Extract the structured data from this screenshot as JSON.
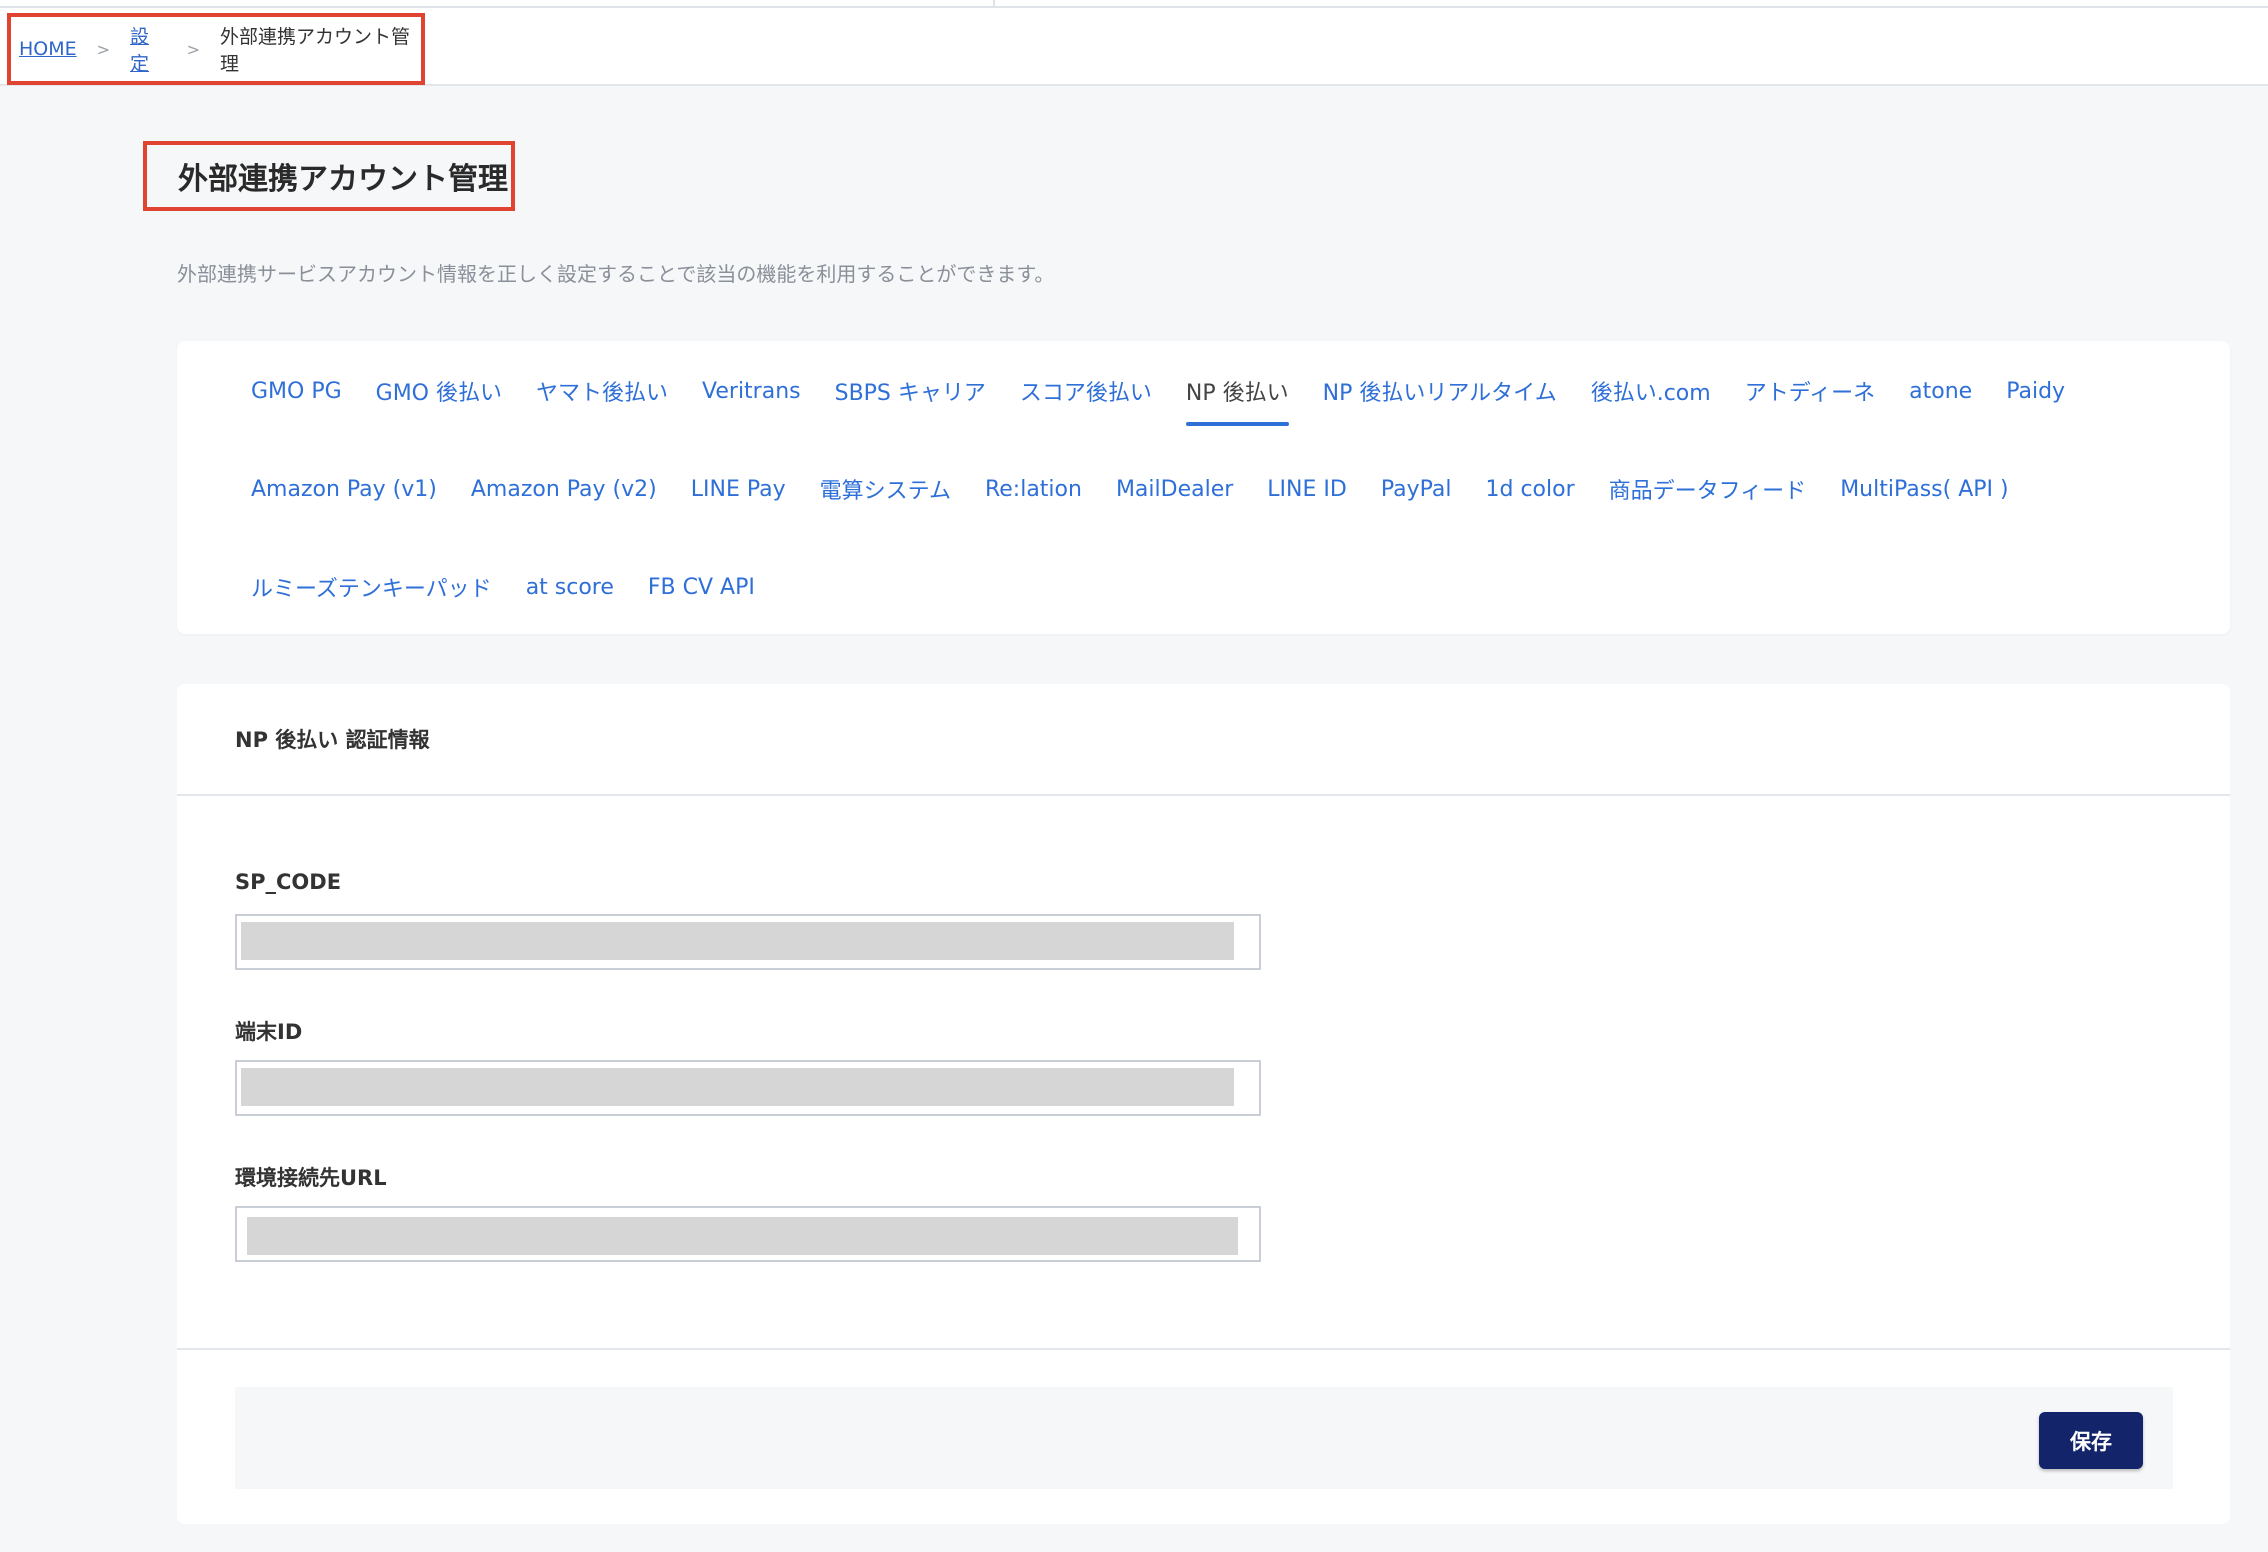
{
  "breadcrumb": {
    "home": "HOME",
    "settings": "設定",
    "current": "外部連携アカウント管理",
    "separator": ">"
  },
  "page": {
    "title": "外部連携アカウント管理",
    "description": "外部連携サービスアカウント情報を正しく設定することで該当の機能を利用することができます。"
  },
  "tabs": {
    "row1": [
      "GMO PG",
      "GMO 後払い",
      "ヤマト後払い",
      "Veritrans",
      "SBPS キャリア",
      "スコア後払い",
      "NP 後払い",
      "NP 後払いリアルタイム",
      "後払い.com",
      "アトディーネ",
      "atone",
      "Paidy"
    ],
    "row2": [
      "Amazon Pay (v1)",
      "Amazon Pay (v2)",
      "LINE Pay",
      "電算システム",
      "Re:lation",
      "MailDealer",
      "LINE ID",
      "PayPal",
      "1d color",
      "商品データフィード",
      "MultiPass( API )"
    ],
    "row3": [
      "ルミーズテンキーパッド",
      "at score",
      "FB CV API"
    ],
    "active": "NP 後払い"
  },
  "form": {
    "heading": "NP 後払い 認証情報",
    "fields": [
      {
        "label": "SP_CODE",
        "value": ""
      },
      {
        "label": "端末ID",
        "value": ""
      },
      {
        "label": "環境接続先URL",
        "value": ""
      }
    ],
    "save_label": "保存"
  },
  "colors": {
    "link": "#2e6fd8",
    "highlight_border": "#e0432f",
    "save_button": "#13246b"
  }
}
